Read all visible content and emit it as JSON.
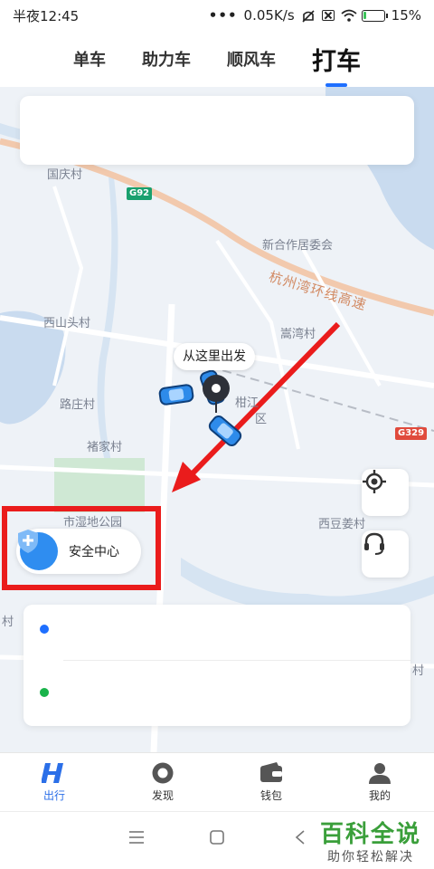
{
  "status_bar": {
    "time": "半夜12:45",
    "network_speed": "0.05K/s",
    "battery": "15%",
    "battery_level": 0.15,
    "icons": [
      "signal-dots-icon",
      "mute-icon",
      "close-box-icon",
      "wifi-icon",
      "battery-charging-icon"
    ]
  },
  "tabs": [
    {
      "label": "单车",
      "active": false
    },
    {
      "label": "助力车",
      "active": false
    },
    {
      "label": "顺风车",
      "active": false
    },
    {
      "label": "打车",
      "active": true
    }
  ],
  "map": {
    "labels": {
      "guoqing": "国庆村",
      "xinhe": "新合作居委会",
      "hangzhouwan_road": "杭州湾环线高速",
      "xishantou": "西山头村",
      "songwan": "嵩湾村",
      "luzhuang": "路庄村",
      "chujia": "褚家村",
      "xidoujiang": "西豆姜村",
      "shidi": "市湿地公园",
      "ganjiang": "柑江",
      "qu": "区",
      "cun_right": "村",
      "cun_left": "村"
    },
    "highway_badges": {
      "g92": "G92",
      "g329": "G329"
    },
    "pickup_tip": "从这里出发",
    "colors": {
      "water": "#c9dbef",
      "green": "#cfe8d4",
      "road": "#ffffff",
      "highway": "#f2c9ad"
    }
  },
  "safety_center": {
    "label": "安全中心",
    "icon": "shield-plus-icon",
    "highlight_color": "#ea1c1c"
  },
  "route_card": {
    "start_dot_color": "#1e6fff",
    "end_dot_color": "#19b34a"
  },
  "bottom_nav": [
    {
      "label": "出行",
      "icon": "travel-h-icon",
      "active": true
    },
    {
      "label": "发现",
      "icon": "discover-icon",
      "active": false
    },
    {
      "label": "钱包",
      "icon": "wallet-icon",
      "active": false
    },
    {
      "label": "我的",
      "icon": "profile-icon",
      "active": false
    }
  ],
  "system_nav": {
    "icons": [
      "menu-icon",
      "home-icon",
      "back-icon"
    ]
  },
  "watermark": {
    "title": "百科全说",
    "subtitle": "助你轻松解决"
  }
}
